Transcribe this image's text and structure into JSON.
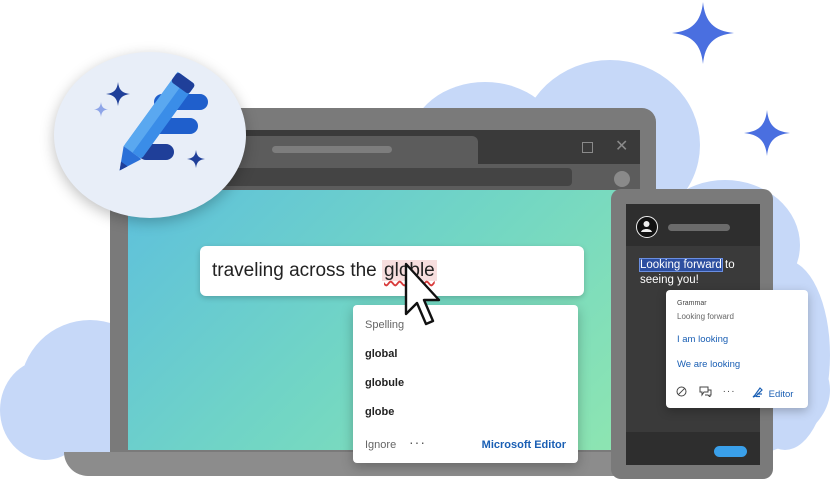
{
  "textbox": {
    "prefix": "traveling across the ",
    "misspelled": "globle"
  },
  "spelling_popup": {
    "header": "Spelling",
    "suggestions": [
      "global",
      "globule",
      "globe"
    ],
    "ignore_label": "Ignore",
    "more_label": "···",
    "editor_label": "Microsoft Editor"
  },
  "phone": {
    "message_highlight": "Looking forward",
    "message_rest": " to seeing you!"
  },
  "grammar_card": {
    "label": "Grammar",
    "original": "Looking forward",
    "options": [
      "I am looking",
      "We are looking"
    ],
    "more_label": "···",
    "editor_label": "Editor"
  },
  "colors": {
    "accent": "#1a5fb4",
    "cloud": "#c6d8f8",
    "sparkle": "#4a6fe0"
  }
}
